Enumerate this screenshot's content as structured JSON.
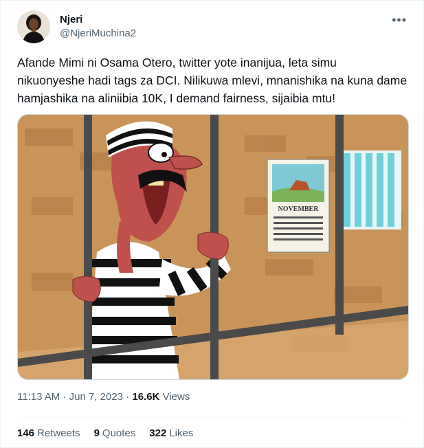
{
  "author": {
    "name": "Njeri",
    "handle": "@NjeriMuchina2"
  },
  "more_icon": "more-dots-icon",
  "tweet": {
    "line1": "Afande Mimi ni Osama Otero, twitter yote inanijua, leta simu",
    "line2": "nikuonyeshe hadi tags za DCI.  Nilikuwa mlevi, mnanishika na kuna dame",
    "line3": "hamjashika na aliniibia 10K, I demand fairness, sijaibia mtu!"
  },
  "image": {
    "calendar_month": "NOVEMBER"
  },
  "meta": {
    "time": "11:13 AM",
    "sep1": "·",
    "date": "Jun 7, 2023",
    "sep2": "·",
    "views_count": "16.6K",
    "views_label": "Views"
  },
  "stats": {
    "retweets_count": "146",
    "retweets_label": "Retweets",
    "quotes_count": "9",
    "quotes_label": "Quotes",
    "likes_count": "322",
    "likes_label": "Likes"
  },
  "colors": {
    "wall": "#c9945a",
    "brick_dark": "#a9743f",
    "bars": "#4a4a4a",
    "skin": "#c0504d",
    "window_bars": "#6fd0d8",
    "text_secondary": "#536471"
  }
}
